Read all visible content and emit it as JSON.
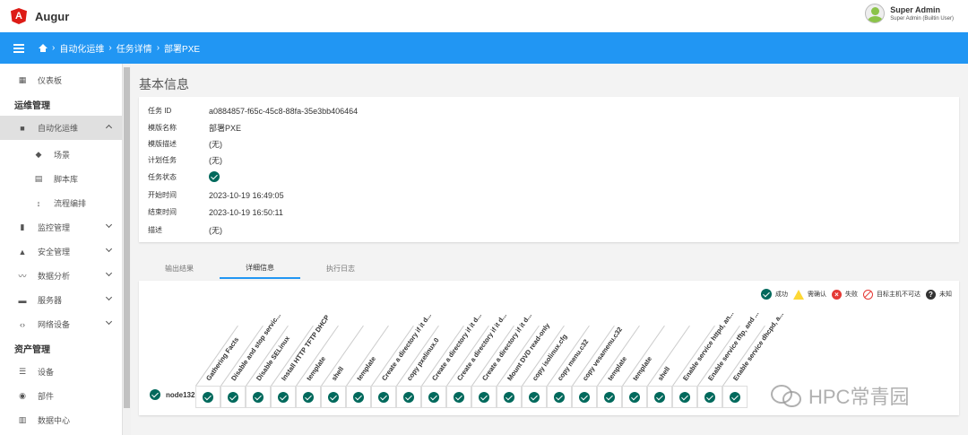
{
  "app": {
    "name": "Augur",
    "logo_letter": "A"
  },
  "user": {
    "name": "Super Admin",
    "subtitle": "Super Admin (Builtin User)"
  },
  "breadcrumb": [
    "自动化运维",
    "任务详情",
    "部署PXE"
  ],
  "sidebar": {
    "items": [
      {
        "label": "仪表板",
        "icon": "dashboard-icon"
      },
      {
        "section": "运维管理"
      },
      {
        "label": "自动化运维",
        "icon": "briefcase-icon",
        "expanded": true
      },
      {
        "label": "场景",
        "icon": "location-icon",
        "sub": true
      },
      {
        "label": "脚本库",
        "icon": "library-icon",
        "sub": true
      },
      {
        "label": "流程编排",
        "icon": "reorder-icon",
        "sub": true
      },
      {
        "label": "监控管理",
        "icon": "bar-chart-icon"
      },
      {
        "label": "安全管理",
        "icon": "warning-icon"
      },
      {
        "label": "数据分析",
        "icon": "trend-icon"
      },
      {
        "label": "服务器",
        "icon": "server-icon"
      },
      {
        "label": "网络设备",
        "icon": "code-icon"
      },
      {
        "section": "资产管理"
      },
      {
        "label": "设备",
        "icon": "list-icon"
      },
      {
        "label": "部件",
        "icon": "globe-icon"
      },
      {
        "label": "数据中心",
        "icon": "building-icon"
      }
    ]
  },
  "page_title": "基本信息",
  "info": {
    "task_id_label": "任务 ID",
    "task_id": "a0884857-f65c-45c8-88fa-35e3bb406464",
    "template_name_label": "模版名称",
    "template_name": "部署PXE",
    "template_desc_label": "模版描述",
    "template_desc": "(无)",
    "plan_task_label": "计划任务",
    "plan_task": "(无)",
    "status_label": "任务状态",
    "status": "success",
    "start_label": "开始时间",
    "start": "2023-10-19 16:49:05",
    "end_label": "结束时间",
    "end": "2023-10-19 16:50:11",
    "desc_label": "描述",
    "desc": "(无)"
  },
  "tabs": [
    "输出结果",
    "详细信息",
    "执行日志"
  ],
  "active_tab": 1,
  "legend": {
    "success": "成功",
    "confirm": "需确认",
    "fail": "失败",
    "unreachable": "目标主机不可达",
    "unknown": "未知",
    "colors": {
      "success": "#00695c",
      "confirm": "#fdd835",
      "fail": "#e53935",
      "unknown": "#333333"
    }
  },
  "node": {
    "name": "node132",
    "status": "success"
  },
  "tasks": [
    "Gathering Facts",
    "Disable and stop servic...",
    "Disable SELinux",
    "Install HTTP TFTP DHCP",
    "template",
    "shell",
    "template",
    "Create a directory if it d...",
    "copy pxelinux.0",
    "Create a directory if it d...",
    "Create a directory if it d...",
    "Create a directory if it d...",
    "Mount DVD read-only",
    "copy isolinux.cfg",
    "copy menu.c32",
    "copy vesamenu.c32",
    "template",
    "template",
    "shell",
    "Enable service httpd, an...",
    "Enable service tftp, and ...",
    "Enable service dhcpd, a..."
  ],
  "watermark": "HPC常青园"
}
